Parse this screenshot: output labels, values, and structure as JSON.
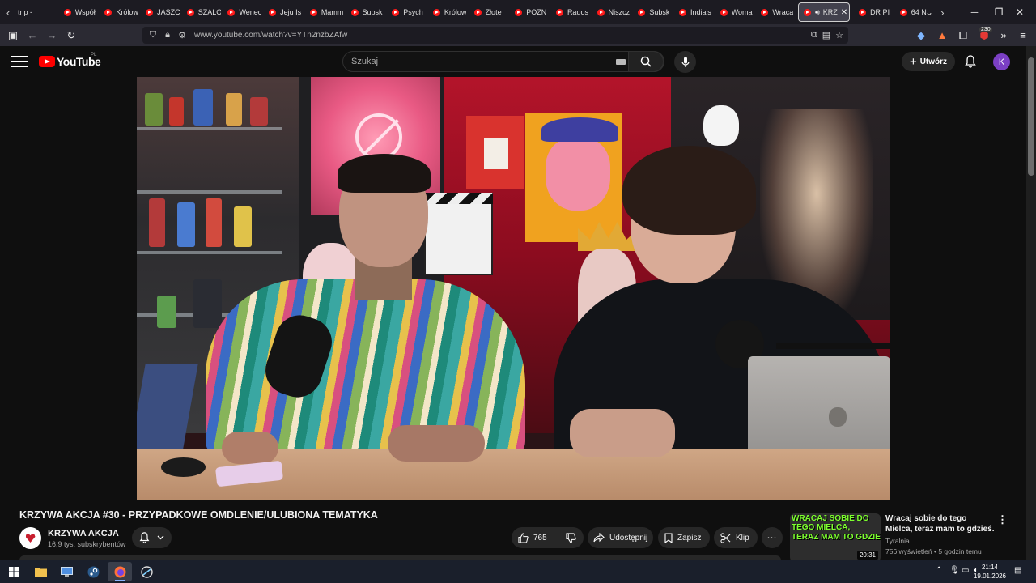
{
  "browser": {
    "tabs": [
      {
        "label": "trip - ",
        "favicon": false
      },
      {
        "label": "Współ",
        "favicon": true
      },
      {
        "label": "Królow",
        "favicon": true
      },
      {
        "label": "JASZC",
        "favicon": true
      },
      {
        "label": "SZALO",
        "favicon": true
      },
      {
        "label": "Wenec",
        "favicon": true
      },
      {
        "label": "Jeju Is",
        "favicon": true
      },
      {
        "label": "Mamm",
        "favicon": true
      },
      {
        "label": "Subsk",
        "favicon": true
      },
      {
        "label": "Psych",
        "favicon": true
      },
      {
        "label": "Królow",
        "favicon": true
      },
      {
        "label": "Złote",
        "favicon": true
      },
      {
        "label": "POZN",
        "favicon": true
      },
      {
        "label": "Rados",
        "favicon": true
      },
      {
        "label": "Niszcz",
        "favicon": true
      },
      {
        "label": "Subsk",
        "favicon": true
      },
      {
        "label": "India's",
        "favicon": true
      },
      {
        "label": "Woma",
        "favicon": true
      },
      {
        "label": "Wraca",
        "favicon": true
      }
    ],
    "active_tab": {
      "label": "KRZ"
    },
    "tabs_after": [
      {
        "label": "DR PI",
        "favicon": true
      },
      {
        "label": "64 N",
        "favicon": true
      }
    ],
    "url": "www.youtube.com/watch?v=YTn2nzbZAfw",
    "extension_badge": "230"
  },
  "youtube": {
    "logo_text": "YouTube",
    "country_code": "PL",
    "search_placeholder": "Szukaj",
    "create_label": "Utwórz",
    "avatar_letter": "K"
  },
  "video": {
    "title": "KRZYWA AKCJA #30 - PRZYPADKOWE OMDLENIE/ULUBIONA TEMATYKA",
    "channel_name": "KRZYWA AKCJA",
    "subscribers": "16,9 tys. subskrybentów",
    "likes": "765",
    "share_label": "Udostępnij",
    "save_label": "Zapisz",
    "clip_label": "Klip"
  },
  "recommended": {
    "thumb_line1": "WRACAJ SOBIE DO TEGO MIELCA,",
    "thumb_line2": "TERAZ MAM TO GDZIE",
    "duration": "20:31",
    "title": "Wracaj sobie do tego Mielca, teraz mam to gdzieś.",
    "channel": "Tyralnia",
    "meta": "756 wyświetleń • 5 godzin temu"
  },
  "taskbar": {
    "time": "21:14",
    "date": "19.01.2026"
  },
  "colors": {
    "youtube_red": "#ff0000",
    "avatar_bg": "#7b3fc4",
    "thumb_text": "#7dff2e"
  }
}
